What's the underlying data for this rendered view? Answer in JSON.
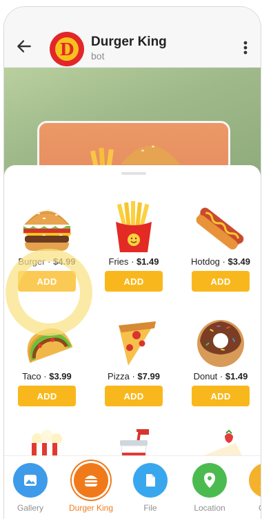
{
  "header": {
    "title": "Durger King",
    "subtitle": "bot",
    "avatar_letter": "D"
  },
  "products": [
    {
      "name": "Burger",
      "price": "$4.99",
      "emoji": "burger-icon",
      "button": "ADD"
    },
    {
      "name": "Fries",
      "price": "$1.49",
      "emoji": "fries-icon",
      "button": "ADD"
    },
    {
      "name": "Hotdog",
      "price": "$3.49",
      "emoji": "hotdog-icon",
      "button": "ADD"
    },
    {
      "name": "Taco",
      "price": "$3.99",
      "emoji": "taco-icon",
      "button": "ADD"
    },
    {
      "name": "Pizza",
      "price": "$7.99",
      "emoji": "pizza-icon",
      "button": "ADD"
    },
    {
      "name": "Donut",
      "price": "$1.49",
      "emoji": "donut-icon",
      "button": "ADD"
    }
  ],
  "attach_bar": {
    "items": [
      {
        "label": "Gallery",
        "icon": "gallery-icon",
        "color": "#3d9be9"
      },
      {
        "label": "Durger King",
        "icon": "burger-icon",
        "color": "#f07a1a",
        "active": true
      },
      {
        "label": "File",
        "icon": "file-icon",
        "color": "#39a7ed"
      },
      {
        "label": "Location",
        "icon": "location-icon",
        "color": "#4cbb4f"
      },
      {
        "label": "Con",
        "icon": "contact-icon",
        "color": "#f4b12b"
      }
    ]
  },
  "colors": {
    "accent": "#f8b81d",
    "active_tab": "#f07a1a"
  }
}
